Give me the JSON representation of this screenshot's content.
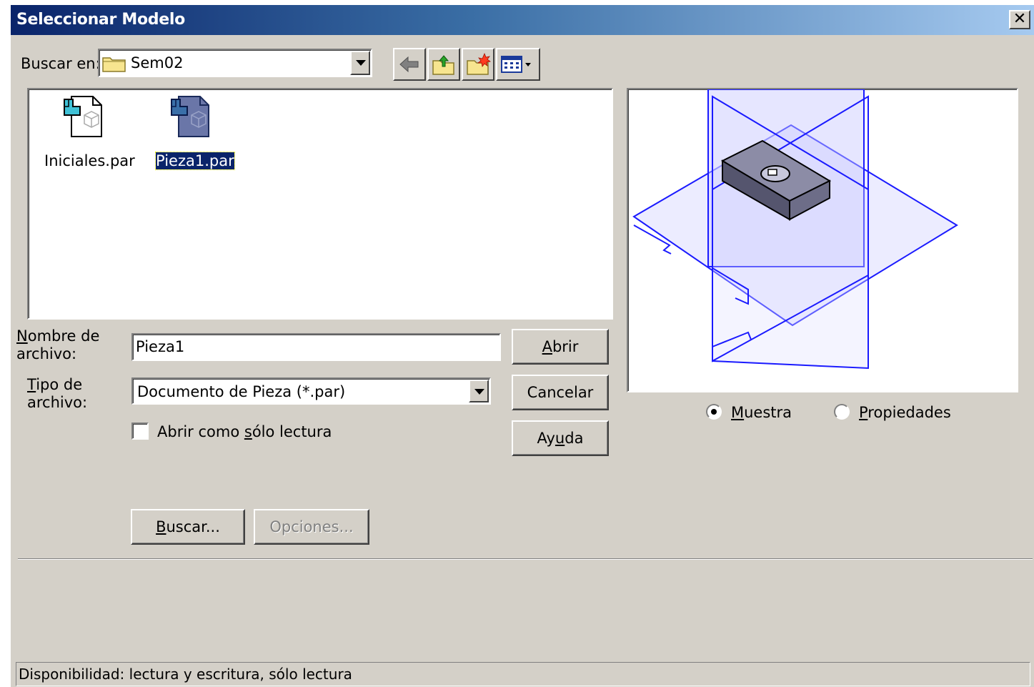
{
  "window": {
    "title": "Seleccionar Modelo",
    "close_glyph": "✕"
  },
  "lookin": {
    "label_pre": "",
    "label_u": "",
    "label": "Buscar en:",
    "value": "Sem02"
  },
  "toolbar": {
    "icons": [
      "back-icon",
      "up-folder-icon",
      "new-folder-icon",
      "view-menu-icon"
    ]
  },
  "files": [
    {
      "name": "Iniciales.par",
      "selected": false
    },
    {
      "name": "Pieza1.par",
      "selected": true
    }
  ],
  "filename": {
    "label_u": "N",
    "label_rest1": "ombre de",
    "label_rest2": "archivo:",
    "value": "Pieza1"
  },
  "filetype": {
    "label_u": "T",
    "label_rest1": "ipo de",
    "label_rest2": "archivo:",
    "value": "Documento de Pieza (*.par)"
  },
  "readonly": {
    "label_pre": "Abrir como ",
    "label_u": "s",
    "label_post": "ólo lectura",
    "checked": false
  },
  "buttons": {
    "open": {
      "u": "A",
      "rest": "brir"
    },
    "cancel": {
      "label": "Cancelar"
    },
    "help": {
      "pre": "Ay",
      "u": "u",
      "post": "da"
    },
    "find": {
      "u": "B",
      "rest": "uscar..."
    },
    "options": {
      "label": "Opciones..."
    }
  },
  "preview_options": {
    "sample": {
      "u": "M",
      "rest": "uestra",
      "selected": true
    },
    "properties": {
      "u": "P",
      "rest": "ropiedades",
      "selected": false
    }
  },
  "status": {
    "text": "Disponibilidad: lectura y escritura, sólo lectura"
  },
  "colors": {
    "title_start": "#0a246a",
    "title_end": "#a6caf0",
    "face": "#d4d0c8",
    "selection": "#0a246a",
    "wire": "#1a1aff"
  }
}
